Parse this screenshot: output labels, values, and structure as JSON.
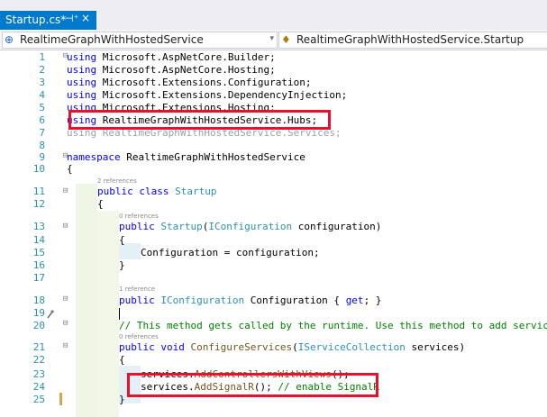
{
  "tab": {
    "title": "Startup.cs*",
    "pin": "⊣⁺",
    "close": "×"
  },
  "navbar": {
    "project": "RealtimeGraphWithHostedService",
    "class": "RealtimeGraphWithHostedService.Startup",
    "arrow": "▾"
  },
  "editor": {
    "line_numbers": [
      "1",
      "2",
      "3",
      "4",
      "5",
      "6",
      "7",
      "8",
      "9",
      "10",
      "11",
      "12",
      "13",
      "14",
      "15",
      "16",
      "17",
      "18",
      "19",
      "20",
      "21",
      "22",
      "23",
      "24",
      "25"
    ],
    "lines": [
      {
        "kw": "using",
        "rest": " Microsoft.AspNetCore.Builder;"
      },
      {
        "kw": "using",
        "rest": " Microsoft.AspNetCore.Hosting;"
      },
      {
        "kw": "using",
        "rest": " Microsoft.Extensions.Configuration;"
      },
      {
        "kw": "using",
        "rest": " Microsoft.Extensions.DependencyInjection;"
      },
      {
        "kw": "using",
        "rest": " Microsoft.Extensions.Hosting;"
      },
      {
        "kw": "using",
        "rest": " RealtimeGraphWithHostedService.Hubs;"
      },
      {
        "kw": "using",
        "rest": " RealtimeGraphWithHostedService.Services;"
      },
      {
        "kw": "namespace",
        "rest": " RealtimeGraphWithHostedService"
      },
      {
        "text": "{"
      },
      {
        "refs": "2 references"
      },
      {
        "kw": "public",
        "kw2": "class",
        "ty": "Startup"
      },
      {
        "text": "{"
      },
      {
        "refs": "0 references"
      },
      {
        "kw": "public",
        "ty": "Startup",
        "p1": "(",
        "ty2": "IConfiguration",
        "p2": " configuration)"
      },
      {
        "text": "{"
      },
      {
        "a": "Configuration = configuration;"
      },
      {
        "text": "}"
      },
      {
        "refs": "1 reference"
      },
      {
        "kw": "public",
        "ty": "IConfiguration",
        "a": " Configuration { ",
        "kw3": "get",
        "b": "; }"
      },
      {
        "comment": "// This method gets called by the runtime. Use this method to add services t"
      },
      {
        "refs": "0 references"
      },
      {
        "kw": "public",
        "kw2": "void",
        "fn": "ConfigureServices",
        "p1": "(",
        "ty2": "IServiceCollection",
        "p2": " services)"
      },
      {
        "text": "{"
      },
      {
        "a": "services.",
        "fn": "AddControllersWithViews",
        "b": "();"
      },
      {
        "a": "services.",
        "fn": "AddSignalR",
        "b": "(); ",
        "comment": "// enable SignalR"
      },
      {
        "text": "}"
      }
    ]
  },
  "colors": {
    "tab_active": "#007acc",
    "highlight_box": "#e8112d",
    "keyword": "#0000ff",
    "type": "#2b91af",
    "method": "#74531f",
    "comment": "#008000"
  },
  "icons": [
    "pin-icon",
    "close-icon",
    "csharp-project-icon",
    "class-icon",
    "dropdown-arrow-icon",
    "lightbulb-icon"
  ]
}
